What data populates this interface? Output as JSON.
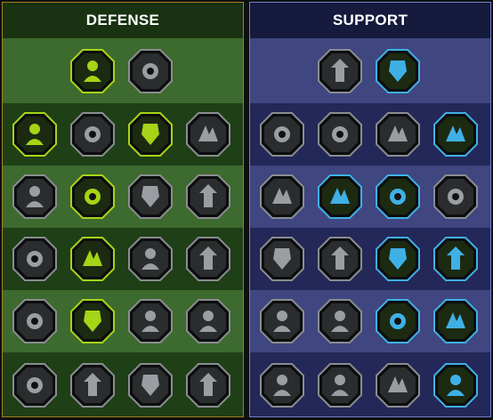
{
  "trees": [
    {
      "title": "DEFENSE",
      "rows": [
        [
          "defense-chart-icon",
          "fist-icon"
        ],
        [
          "chevron-shield-icon",
          "heart-hand-icon",
          "golem-icon",
          "crossed-blades-icon"
        ],
        [
          "figure-shield-icon",
          "knight-shield-icon",
          "heart-skull-icon",
          "shielded-head-icon"
        ],
        [
          "crowd-icon",
          "hourglass-icon",
          "open-palm-icon",
          "bull-skull-icon"
        ],
        [
          "dash-figure-icon",
          "drops-icon",
          "skull-spikes-icon",
          "dodge-icon"
        ],
        [
          "demon-head-icon",
          "armored-chest-icon",
          "sumo-icon",
          "flexing-figure-icon"
        ]
      ],
      "active": [
        [
          true,
          false
        ],
        [
          true,
          false,
          true,
          false
        ],
        [
          false,
          true,
          false,
          false
        ],
        [
          false,
          true,
          false,
          false
        ],
        [
          false,
          true,
          false,
          false
        ],
        [
          false,
          false,
          false,
          false
        ]
      ]
    },
    {
      "title": "SUPPORT",
      "rows": [
        [
          "heart-sparkle-icon",
          "target-burst-icon"
        ],
        [
          "praying-hands-icon",
          "shield-aura-icon",
          "flaming-skull-icon",
          "dashing-beam-icon"
        ],
        [
          "meditating-figure-icon",
          "lightning-icon",
          "shatter-icon",
          "shadow-figures-icon"
        ],
        [
          "heart-chain-icon",
          "comet-icon",
          "book-icon",
          "fierce-face-icon"
        ],
        [
          "compass-star-icon",
          "speed-boot-icon",
          "eye-icon",
          "jumping-figure-icon"
        ],
        [
          "potion-icon",
          "skull-icon",
          "fist-bump-icon",
          "eagle-icon"
        ]
      ],
      "active": [
        [
          false,
          true
        ],
        [
          false,
          false,
          false,
          true
        ],
        [
          false,
          true,
          true,
          false
        ],
        [
          false,
          false,
          true,
          true
        ],
        [
          false,
          false,
          true,
          true
        ],
        [
          false,
          false,
          false,
          true
        ]
      ]
    }
  ],
  "colors": {
    "defense_accent": "#a6d417",
    "support_accent": "#3fb0e6",
    "inactive": "#2a2c2e"
  }
}
